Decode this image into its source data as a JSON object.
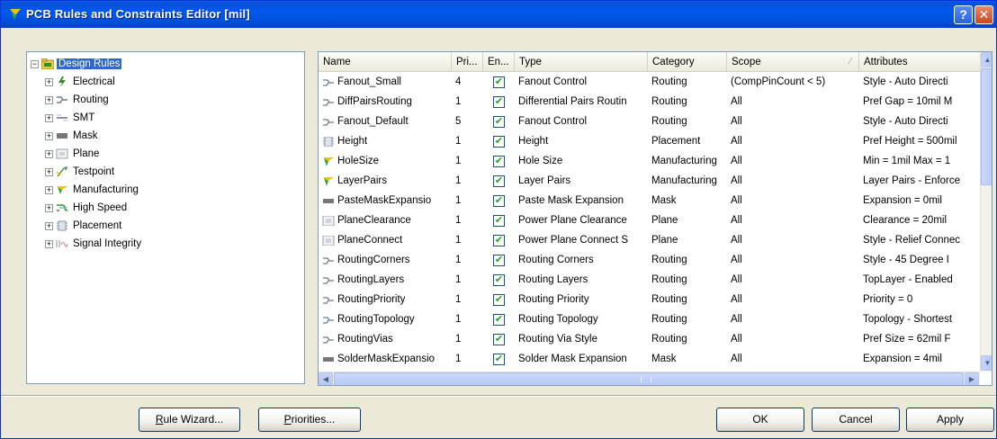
{
  "window": {
    "title": "PCB Rules and Constraints Editor [mil]",
    "help_label": "?",
    "close_label": "✕"
  },
  "tree": {
    "root": "Design Rules",
    "items": [
      {
        "label": "Electrical",
        "icon": "electrical-icon"
      },
      {
        "label": "Routing",
        "icon": "routing-icon"
      },
      {
        "label": "SMT",
        "icon": "smt-icon"
      },
      {
        "label": "Mask",
        "icon": "mask-icon"
      },
      {
        "label": "Plane",
        "icon": "plane-icon"
      },
      {
        "label": "Testpoint",
        "icon": "testpoint-icon"
      },
      {
        "label": "Manufacturing",
        "icon": "manufacturing-icon"
      },
      {
        "label": "High Speed",
        "icon": "high-speed-icon"
      },
      {
        "label": "Placement",
        "icon": "placement-icon"
      },
      {
        "label": "Signal Integrity",
        "icon": "signal-integrity-icon"
      }
    ]
  },
  "grid": {
    "columns": [
      "Name",
      "Pri...",
      "En...",
      "Type",
      "Category",
      "Scope",
      "Attributes"
    ],
    "rows": [
      {
        "name": "Fanout_Small",
        "icon": "routing-rule-icon",
        "priority": "4",
        "enabled": true,
        "type": "Fanout Control",
        "category": "Routing",
        "scope": "(CompPinCount < 5)",
        "attributes": "Style - Auto   Directi"
      },
      {
        "name": "DiffPairsRouting",
        "icon": "routing-rule-icon",
        "priority": "1",
        "enabled": true,
        "type": "Differential Pairs Routin",
        "category": "Routing",
        "scope": "All",
        "attributes": "Pref Gap = 10mil   M"
      },
      {
        "name": "Fanout_Default",
        "icon": "routing-rule-icon",
        "priority": "5",
        "enabled": true,
        "type": "Fanout Control",
        "category": "Routing",
        "scope": "All",
        "attributes": "Style - Auto   Directi"
      },
      {
        "name": "Height",
        "icon": "placement-rule-icon",
        "priority": "1",
        "enabled": true,
        "type": "Height",
        "category": "Placement",
        "scope": "All",
        "attributes": "Pref Height = 500mil"
      },
      {
        "name": "HoleSize",
        "icon": "manufacturing-rule-icon",
        "priority": "1",
        "enabled": true,
        "type": "Hole Size",
        "category": "Manufacturing",
        "scope": "All",
        "attributes": "Min = 1mil   Max = 1"
      },
      {
        "name": "LayerPairs",
        "icon": "manufacturing-rule-icon",
        "priority": "1",
        "enabled": true,
        "type": "Layer Pairs",
        "category": "Manufacturing",
        "scope": "All",
        "attributes": "Layer Pairs - Enforce"
      },
      {
        "name": "PasteMaskExpansio",
        "icon": "mask-rule-icon",
        "priority": "1",
        "enabled": true,
        "type": "Paste Mask Expansion",
        "category": "Mask",
        "scope": "All",
        "attributes": "Expansion = 0mil"
      },
      {
        "name": "PlaneClearance",
        "icon": "plane-rule-icon",
        "priority": "1",
        "enabled": true,
        "type": "Power Plane Clearance",
        "category": "Plane",
        "scope": "All",
        "attributes": "Clearance = 20mil"
      },
      {
        "name": "PlaneConnect",
        "icon": "plane-rule-icon",
        "priority": "1",
        "enabled": true,
        "type": "Power Plane Connect S",
        "category": "Plane",
        "scope": "All",
        "attributes": "Style - Relief Connec"
      },
      {
        "name": "RoutingCorners",
        "icon": "routing-rule-icon",
        "priority": "1",
        "enabled": true,
        "type": "Routing Corners",
        "category": "Routing",
        "scope": "All",
        "attributes": "Style - 45 Degree   I"
      },
      {
        "name": "RoutingLayers",
        "icon": "routing-rule-icon",
        "priority": "1",
        "enabled": true,
        "type": "Routing Layers",
        "category": "Routing",
        "scope": "All",
        "attributes": "TopLayer - Enabled"
      },
      {
        "name": "RoutingPriority",
        "icon": "routing-rule-icon",
        "priority": "1",
        "enabled": true,
        "type": "Routing Priority",
        "category": "Routing",
        "scope": "All",
        "attributes": "Priority = 0"
      },
      {
        "name": "RoutingTopology",
        "icon": "routing-rule-icon",
        "priority": "1",
        "enabled": true,
        "type": "Routing Topology",
        "category": "Routing",
        "scope": "All",
        "attributes": "Topology - Shortest"
      },
      {
        "name": "RoutingVias",
        "icon": "routing-rule-icon",
        "priority": "1",
        "enabled": true,
        "type": "Routing Via Style",
        "category": "Routing",
        "scope": "All",
        "attributes": "Pref Size = 62mil   F"
      },
      {
        "name": "SolderMaskExpansio",
        "icon": "mask-rule-icon",
        "priority": "1",
        "enabled": true,
        "type": "Solder Mask Expansion",
        "category": "Mask",
        "scope": "All",
        "attributes": "Expansion = 4mil"
      }
    ]
  },
  "buttons": {
    "rule_wizard": {
      "accel": "R",
      "rest": "ule Wizard..."
    },
    "priorities": {
      "accel": "P",
      "rest": "riorities..."
    },
    "ok": "OK",
    "cancel": "Cancel",
    "apply": "Apply"
  },
  "colors": {
    "titlebar": "#0058ee",
    "selection": "#316ac5",
    "check": "#21a121"
  }
}
